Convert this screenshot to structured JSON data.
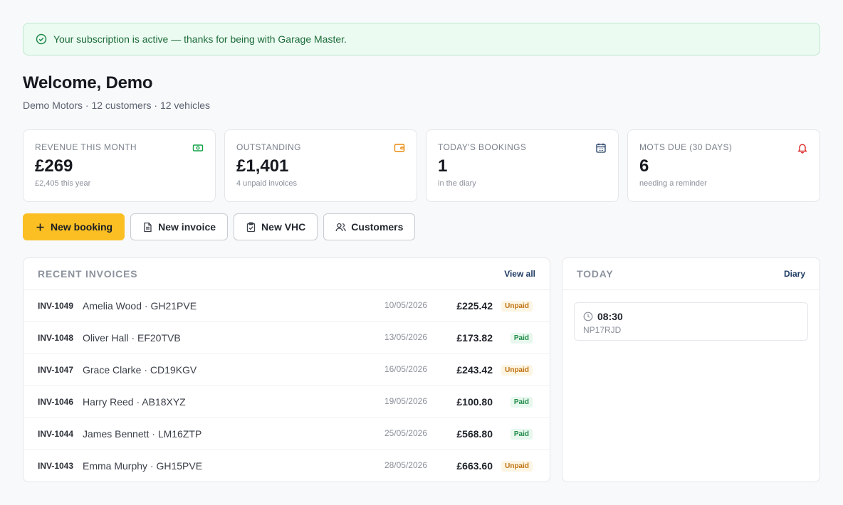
{
  "banner": {
    "text": "Your subscription is active — thanks for being with Garage Master.",
    "icon": "check-circle-icon"
  },
  "welcome": {
    "title": "Welcome, Demo",
    "subtitle": "Demo Motors · 12 customers · 12 vehicles"
  },
  "stats": [
    {
      "label": "REVENUE THIS MONTH",
      "value": "£269",
      "sub": "£2,405 this year",
      "icon": "banknote-icon",
      "color": "#16a34a"
    },
    {
      "label": "OUTSTANDING",
      "value": "£1,401",
      "sub": "4 unpaid invoices",
      "icon": "wallet-icon",
      "color": "#ea8a0c"
    },
    {
      "label": "TODAY'S BOOKINGS",
      "value": "1",
      "sub": "in the diary",
      "icon": "calendar-icon",
      "color": "#1f3b63"
    },
    {
      "label": "MOTS DUE (30 DAYS)",
      "value": "6",
      "sub": "needing a reminder",
      "icon": "bell-icon",
      "color": "#dc2626"
    }
  ],
  "actions": {
    "new_booking": "New booking",
    "new_invoice": "New invoice",
    "new_vhc": "New VHC",
    "customers": "Customers"
  },
  "invoices": {
    "title": "RECENT INVOICES",
    "view_all": "View all",
    "rows": [
      {
        "num": "INV-1049",
        "customer": "Amelia Wood · GH21PVE",
        "date": "10/05/2026",
        "amount": "£225.42",
        "status": "Unpaid"
      },
      {
        "num": "INV-1048",
        "customer": "Oliver Hall · EF20TVB",
        "date": "13/05/2026",
        "amount": "£173.82",
        "status": "Paid"
      },
      {
        "num": "INV-1047",
        "customer": "Grace Clarke · CD19KGV",
        "date": "16/05/2026",
        "amount": "£243.42",
        "status": "Unpaid"
      },
      {
        "num": "INV-1046",
        "customer": "Harry Reed · AB18XYZ",
        "date": "19/05/2026",
        "amount": "£100.80",
        "status": "Paid"
      },
      {
        "num": "INV-1044",
        "customer": "James Bennett · LM16ZTP",
        "date": "25/05/2026",
        "amount": "£568.80",
        "status": "Paid"
      },
      {
        "num": "INV-1043",
        "customer": "Emma Murphy · GH15PVE",
        "date": "28/05/2026",
        "amount": "£663.60",
        "status": "Unpaid"
      }
    ]
  },
  "today": {
    "title": "TODAY",
    "diary_link": "Diary",
    "bookings": [
      {
        "time": "08:30",
        "reg": "NP17RJD"
      }
    ]
  },
  "colors": {
    "accent": "#fbbf24",
    "link": "#1f3b63",
    "success": "#16a34a",
    "warning": "#ea8a0c",
    "danger": "#dc2626"
  }
}
